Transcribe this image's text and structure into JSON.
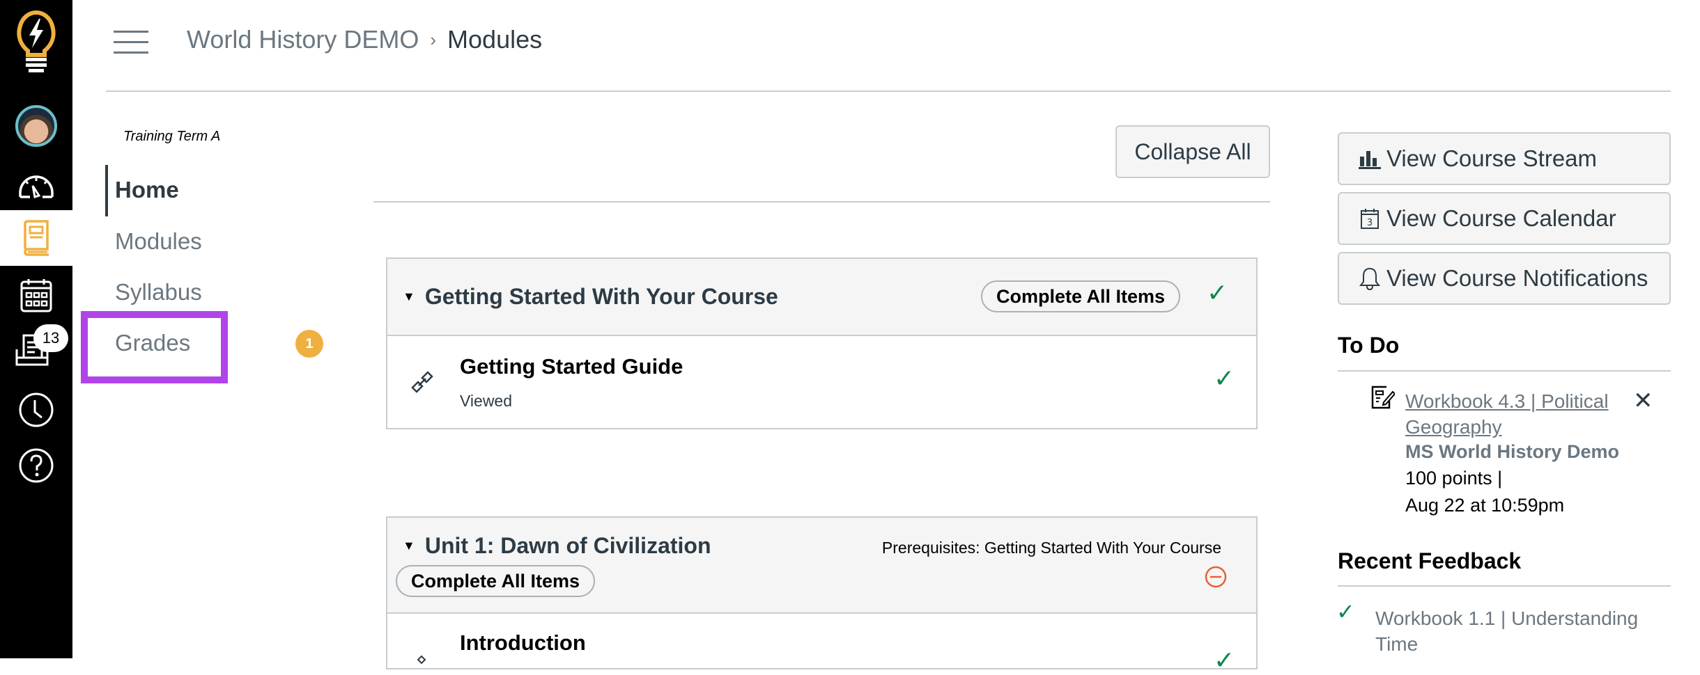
{
  "global_nav": {
    "items": [
      {
        "name": "logo",
        "icon": "lightbulb-logo-icon"
      },
      {
        "name": "account",
        "icon": "avatar"
      },
      {
        "name": "dashboard",
        "icon": "dashboard-icon"
      },
      {
        "name": "courses",
        "icon": "book-icon",
        "active": true
      },
      {
        "name": "calendar",
        "icon": "calendar-icon"
      },
      {
        "name": "inbox",
        "icon": "inbox-icon",
        "badge": "13"
      },
      {
        "name": "history",
        "icon": "clock-icon"
      },
      {
        "name": "help",
        "icon": "help-icon"
      }
    ],
    "inbox_badge": "13",
    "accent_color": "#f0b03f"
  },
  "header": {
    "breadcrumb": {
      "course": "World History DEMO",
      "separator": "›",
      "current": "Modules"
    }
  },
  "course_nav": {
    "term": "Training Term A",
    "items": [
      {
        "label": "Home",
        "active": true
      },
      {
        "label": "Modules"
      },
      {
        "label": "Syllabus"
      },
      {
        "label": "Grades",
        "highlighted": true,
        "badge": "1"
      }
    ],
    "highlight_color": "#b044e8"
  },
  "main": {
    "collapse_all_label": "Collapse All",
    "modules": [
      {
        "title": "Getting Started With Your Course",
        "complete_all_label": "Complete All Items",
        "status": "completed",
        "items": [
          {
            "title": "Getting Started Guide",
            "subtitle": "Viewed",
            "icon": "link-icon",
            "status": "completed"
          }
        ]
      },
      {
        "title": "Unit 1: Dawn of Civilization",
        "complete_all_label": "Complete All Items",
        "prerequisites": "Prerequisites: Getting Started With Your Course",
        "status": "locked",
        "items": [
          {
            "title": "Introduction",
            "icon": "link-icon",
            "status": "completed"
          }
        ]
      }
    ]
  },
  "sidebar": {
    "buttons": [
      {
        "label": "View Course Stream",
        "icon": "bar-chart-icon"
      },
      {
        "label": "View Course Calendar",
        "icon": "calendar-icon",
        "icon_text": "3"
      },
      {
        "label": "View Course Notifications",
        "icon": "bell-icon"
      }
    ],
    "todo": {
      "heading": "To Do",
      "items": [
        {
          "title": "Workbook 4.3 | Political Geography",
          "course": "MS World History Demo",
          "points": "100 points  |",
          "due": "Aug 22 at 10:59pm",
          "dismiss": "✕"
        }
      ]
    },
    "recent_feedback": {
      "heading": "Recent Feedback",
      "items": [
        {
          "title": "Workbook 1.1 | Understanding Time"
        }
      ]
    }
  }
}
